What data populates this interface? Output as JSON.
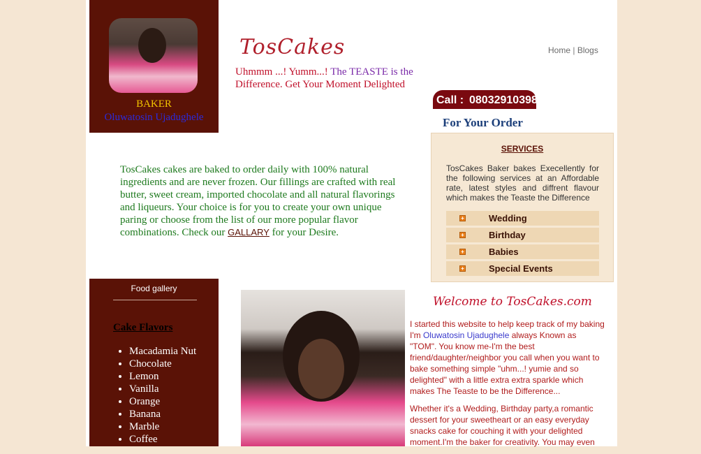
{
  "brand": {
    "logo_text": "TosCakes"
  },
  "profile": {
    "title": "BAKER",
    "name": "Oluwatosin Ujadughele"
  },
  "tagline": {
    "part1": "Uhmmm ...! Yumm...! ",
    "part2": "The TEASTE is the",
    "part3": "Difference. Get Your Moment Delighted"
  },
  "nav": {
    "home": "Home",
    "separator": "|",
    "blogs": "Blogs"
  },
  "call": {
    "label": "Call :",
    "number": "08032910398"
  },
  "order_text": "For Your Order",
  "intro": {
    "text": "TosCakes cakes are baked to order daily with 100% natural ingredients and are never frozen. Our fillings are crafted with real butter, sweet cream, imported chocolate and all natural flavorings and liqueurs. Your choice is for you to create your own unique paring or choose from the list of our more popular flavor combinations. Check our ",
    "gallery_link": "GALLARY",
    "suffix": " for your Desire."
  },
  "services": {
    "heading": "SERVICES",
    "description": "TosCakes Baker bakes Execellently for the following services at an Affordable rate, latest styles and diffrent flavour which makes the Teaste the Difference",
    "items": [
      {
        "label": "Wedding"
      },
      {
        "label": "Birthday"
      },
      {
        "label": "Babies"
      },
      {
        "label": "Special Events"
      }
    ]
  },
  "gallery": {
    "title": "Food gallery",
    "flavors_heading": "Cake Flavors",
    "flavors": [
      "Macadamia Nut",
      "Chocolate",
      "Lemon",
      "Vanilla",
      "Orange",
      "Banana",
      "Marble",
      "Coffee"
    ]
  },
  "welcome": {
    "heading": "Welcome to TosCakes.com",
    "p1_a": "I started this website to help keep track of my baking I'm ",
    "p1_name": "Oluwatosin Ujadughele",
    "p1_b": " always Known as \"TOM\". You know me-I'm the best friend/daughter/neighbor you call when you want to bake something simple \"uhm...! yumie and so delighted\" with a little extra extra sparkle which makes The Teaste to be the Difference...",
    "p2": "Whether it's a Wedding, Birthday party,a romantic dessert for your sweetheart or an easy everyday snacks cake for couching it with your delighted moment.I'm the baker for creativity. You may even"
  },
  "colors": {
    "maroon": "#5a1206",
    "page_bg": "#f5e6d3",
    "accent_red": "#c0102a",
    "green_text": "#1e7a1e"
  }
}
